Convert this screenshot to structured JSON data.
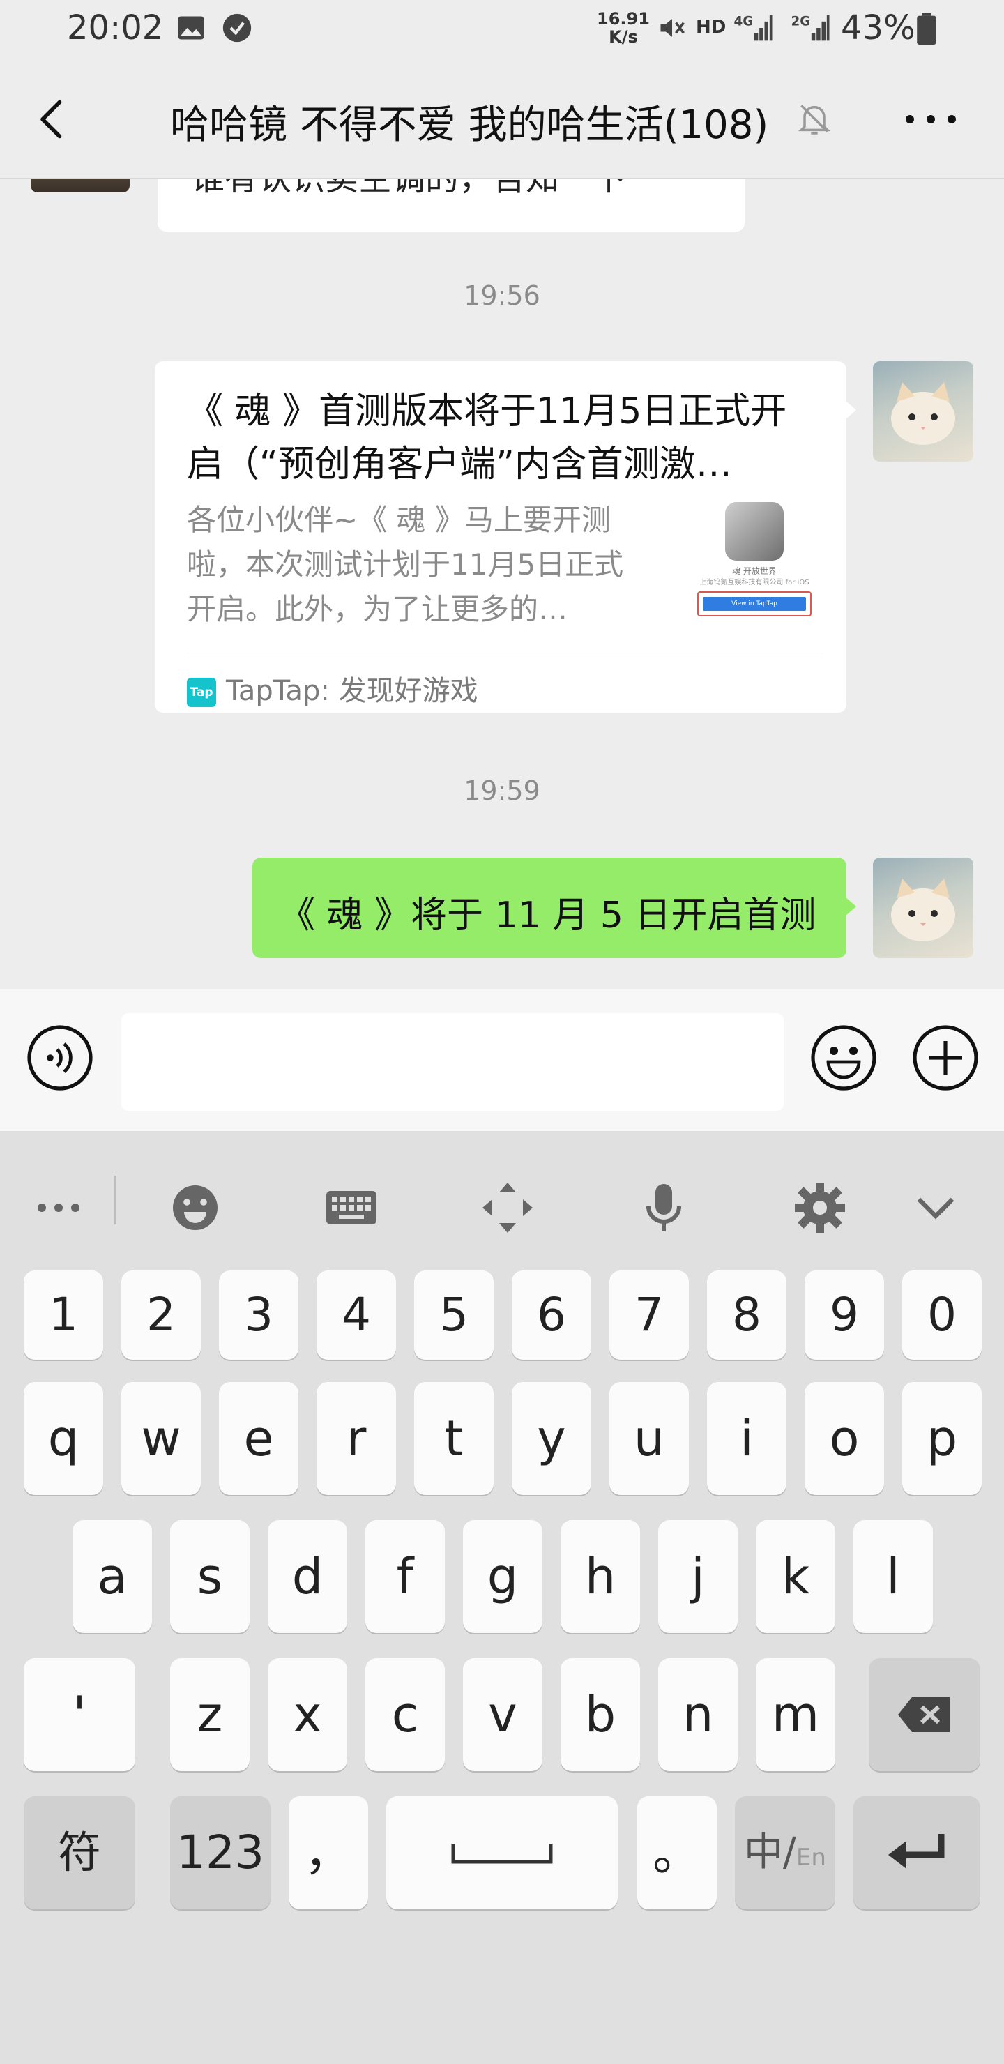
{
  "status_bar": {
    "time": "20:02",
    "net_speed_value": "16.91",
    "net_speed_unit": "K/s",
    "hd_label": "HD",
    "battery_percent": "43%",
    "icons": [
      "image-icon",
      "app-badge-icon",
      "mute-icon",
      "4g-signal-icon",
      "2g-signal-icon",
      "battery-icon"
    ]
  },
  "header": {
    "title": "哈哈镜 不得不爱 我的哈生活(108)",
    "back_icon": "chevron-left-icon",
    "mute_icon": "bell-off-icon",
    "more_icon": "more-dots-icon"
  },
  "chat": {
    "previous_message_partial": "谁有认识卖空调的，告知一下",
    "messages": [
      {
        "timestamp": "19:56",
        "type": "link_card",
        "title": "《 魂 》首测版本将于11月5日正式开启（“预创角客户端”内含首测激…",
        "description": "各位小伙伴~《 魂 》马上要开测啦，本次测试计划于11月5日正式开启。此外，为了让更多的…",
        "thumb_line1": "魂 开放世界",
        "thumb_line2": "上海钨氪互娱科技有限公司 for iOS",
        "thumb_button": "View in TapTap",
        "source_logo": "Tap",
        "source": "TapTap: 发现好游戏"
      },
      {
        "timestamp": "19:59",
        "type": "text",
        "text": "《 魂 》将于 11 月 5 日开启首测"
      }
    ]
  },
  "input_bar": {
    "value": "",
    "voice_icon": "voice-icon",
    "emoji_icon": "emoji-icon",
    "plus_icon": "plus-circle-icon"
  },
  "keyboard": {
    "toolbar": [
      "more-dots-icon",
      "emoji-face-icon",
      "keyboard-icon",
      "cursor-move-icon",
      "mic-icon",
      "gear-icon",
      "chevron-down-icon"
    ],
    "row_numbers": [
      "1",
      "2",
      "3",
      "4",
      "5",
      "6",
      "7",
      "8",
      "9",
      "0"
    ],
    "row1": [
      "q",
      "w",
      "e",
      "r",
      "t",
      "y",
      "u",
      "i",
      "o",
      "p"
    ],
    "row2": [
      "a",
      "s",
      "d",
      "f",
      "g",
      "h",
      "j",
      "k",
      "l"
    ],
    "row3_left": "'",
    "row3": [
      "z",
      "x",
      "c",
      "v",
      "b",
      "n",
      "m"
    ],
    "backspace_icon": "backspace-icon",
    "symbol_key": "符",
    "num_key": "123",
    "comma_key": "，",
    "space_icon": "space-bar-icon",
    "period_key": "。",
    "lang_key_main": "中/",
    "lang_key_sub": "En",
    "enter_icon": "enter-icon"
  }
}
